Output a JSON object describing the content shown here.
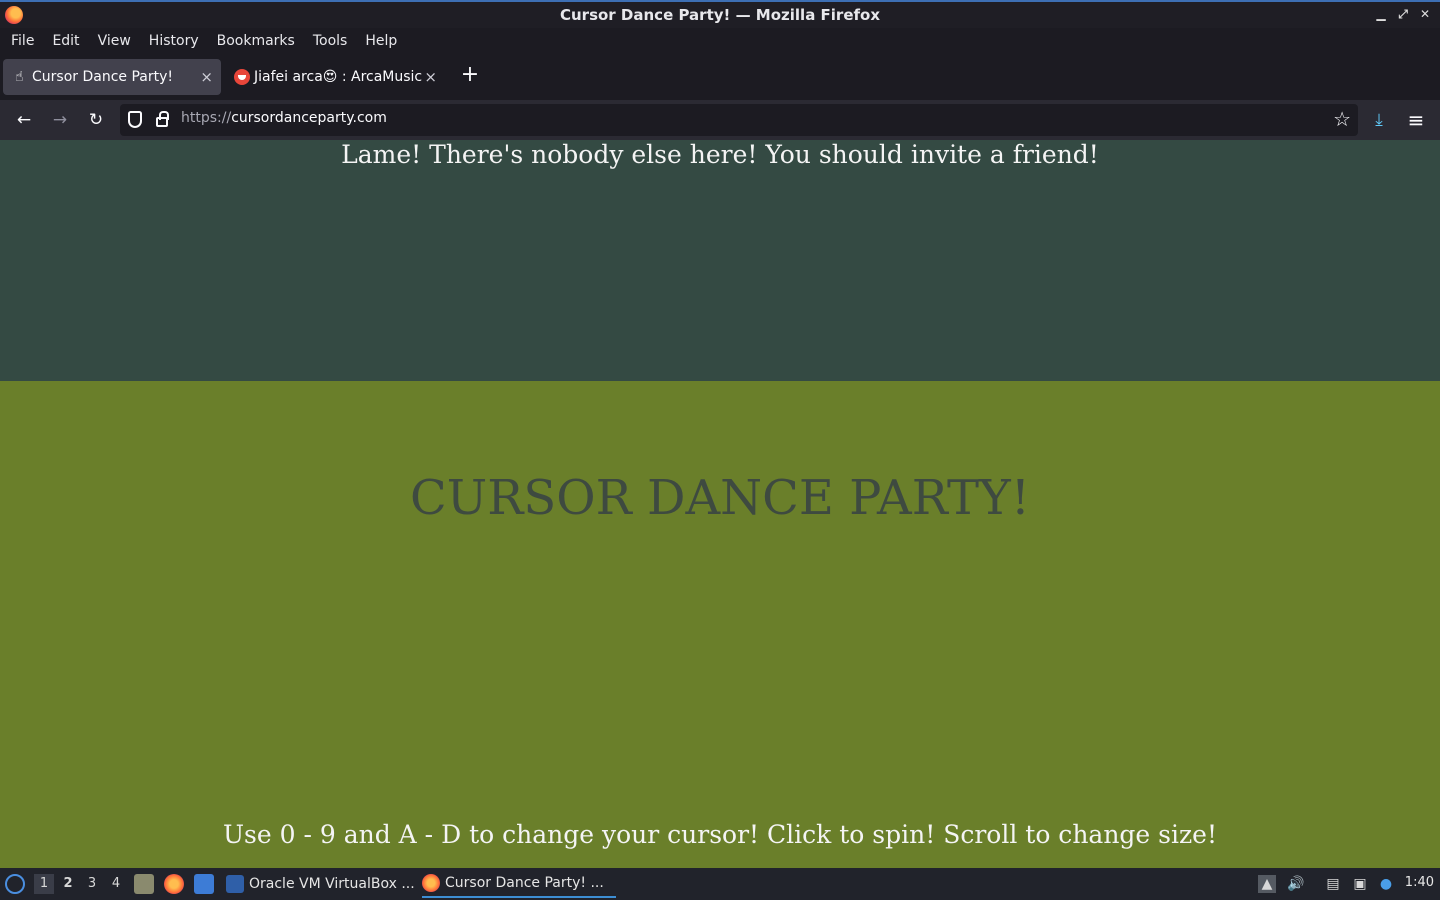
{
  "window": {
    "title": "Cursor Dance Party! — Mozilla Firefox",
    "controls": [
      "minimize-icon",
      "maximize-icon",
      "close-icon"
    ]
  },
  "menubar": {
    "items": [
      "File",
      "Edit",
      "View",
      "History",
      "Bookmarks",
      "Tools",
      "Help"
    ]
  },
  "tabs": [
    {
      "label": "Cursor Dance Party!",
      "active": true,
      "close": "×"
    },
    {
      "label": "Jiafei arca😍 : ArcaMusic",
      "active": false,
      "close": "×"
    }
  ],
  "newtab_label": "+",
  "navbar": {
    "back": "←",
    "forward": "→",
    "reload": "↻",
    "url_scheme": "https://",
    "url_host": "cursordanceparty.com",
    "star": "☆",
    "download": "⤓",
    "menu": "≡"
  },
  "page": {
    "notice": "Lame! There's nobody else here! You should invite a friend!",
    "headline": "CURSOR DANCE PARTY!",
    "instructions": "Use 0 - 9 and A - D to change your cursor! Click to spin! Scroll to change size!",
    "colors": {
      "top_band": "#344a43",
      "bottom_band": "#6a7f2a",
      "headline": "#3e4a40"
    }
  },
  "taskbar": {
    "workspaces": [
      "1",
      "2",
      "3",
      "4"
    ],
    "current_workspace": "1",
    "tasks": [
      {
        "label": "Oracle VM VirtualBox ...",
        "active": false
      },
      {
        "label": "Cursor Dance Party! ...",
        "active": true
      }
    ],
    "clock": "1:40"
  }
}
